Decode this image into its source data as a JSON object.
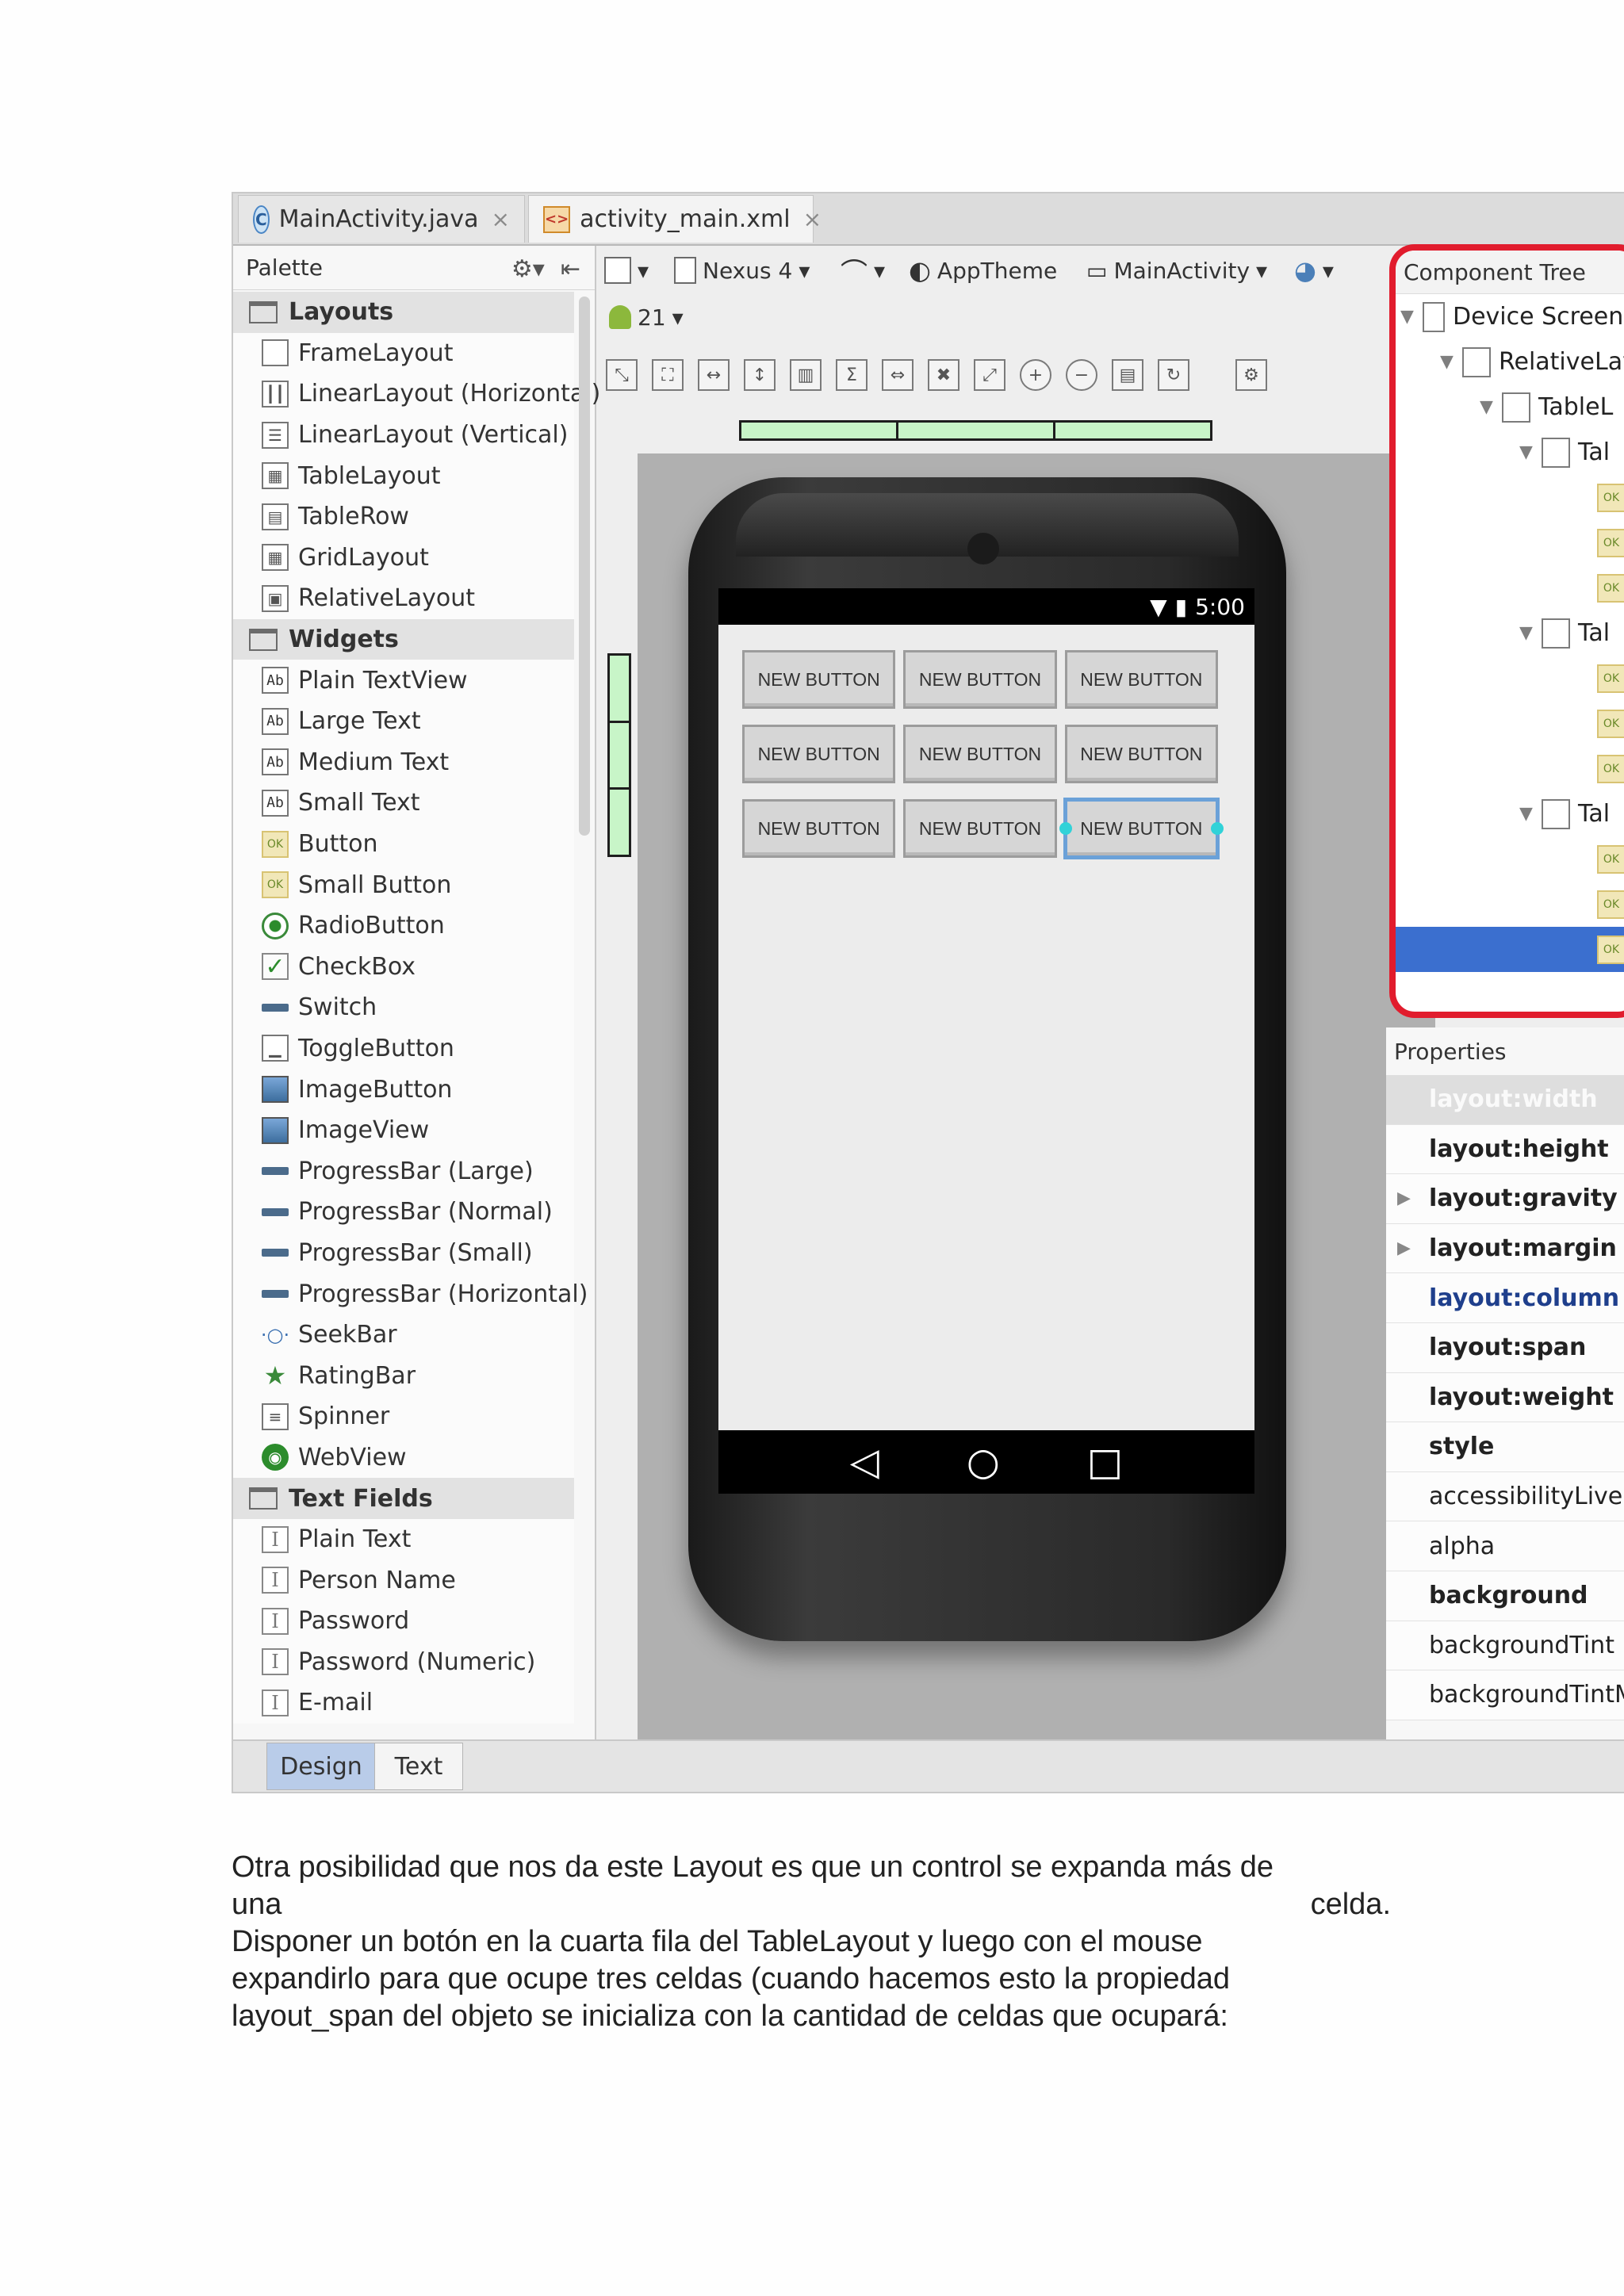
{
  "tabs": [
    {
      "label": "MainActivity.java",
      "icon": "java-class-icon"
    },
    {
      "label": "activity_main.xml",
      "icon": "xml-file-icon"
    }
  ],
  "palette": {
    "title": "Palette",
    "categories": [
      {
        "name": "Layouts",
        "items": [
          "FrameLayout",
          "LinearLayout (Horizontal)",
          "LinearLayout (Vertical)",
          "TableLayout",
          "TableRow",
          "GridLayout",
          "RelativeLayout"
        ]
      },
      {
        "name": "Widgets",
        "items": [
          "Plain TextView",
          "Large Text",
          "Medium Text",
          "Small Text",
          "Button",
          "Small Button",
          "RadioButton",
          "CheckBox",
          "Switch",
          "ToggleButton",
          "ImageButton",
          "ImageView",
          "ProgressBar (Large)",
          "ProgressBar (Normal)",
          "ProgressBar (Small)",
          "ProgressBar (Horizontal)",
          "SeekBar",
          "RatingBar",
          "Spinner",
          "WebView"
        ]
      },
      {
        "name": "Text Fields",
        "items": [
          "Plain Text",
          "Person Name",
          "Password",
          "Password (Numeric)",
          "E-mail"
        ]
      }
    ]
  },
  "toolbar": {
    "device": "Nexus 4",
    "theme": "AppTheme",
    "activity": "MainActivity",
    "api": "21"
  },
  "phone": {
    "time": "5:00",
    "buttons": [
      [
        "NEW BUTTON",
        "NEW BUTTON",
        "NEW BUTTON"
      ],
      [
        "NEW BUTTON",
        "NEW BUTTON",
        "NEW BUTTON"
      ],
      [
        "NEW BUTTON",
        "NEW BUTTON",
        "NEW BUTTON"
      ]
    ]
  },
  "bottom_tabs": {
    "design": "Design",
    "text": "Text"
  },
  "component_tree": {
    "title": "Component Tree",
    "rows": [
      "Device Screen",
      "RelativeLay",
      "TableL",
      "Tal",
      "Tal",
      "Tal"
    ]
  },
  "properties": {
    "title": "Properties",
    "rows": [
      "layout:width",
      "layout:height",
      "layout:gravity",
      "layout:margin",
      "layout:column",
      "layout:span",
      "layout:weight",
      "style",
      "accessibilityLiveRe",
      "alpha",
      "background",
      "backgroundTint",
      "backgroundTintM"
    ]
  },
  "paragraph": {
    "line1": "Otra posibilidad que nos da este Layout es que un control se expanda más de",
    "line2_left": "una",
    "line2_right": "celda.",
    "line3": "Disponer un botón en la cuarta fila del TableLayout y luego con el mouse",
    "line4": "expandirlo para que ocupe tres celdas (cuando hacemos esto la propiedad",
    "line5": "layout_span del objeto se inicializa con la cantidad de celdas que ocupará:"
  }
}
